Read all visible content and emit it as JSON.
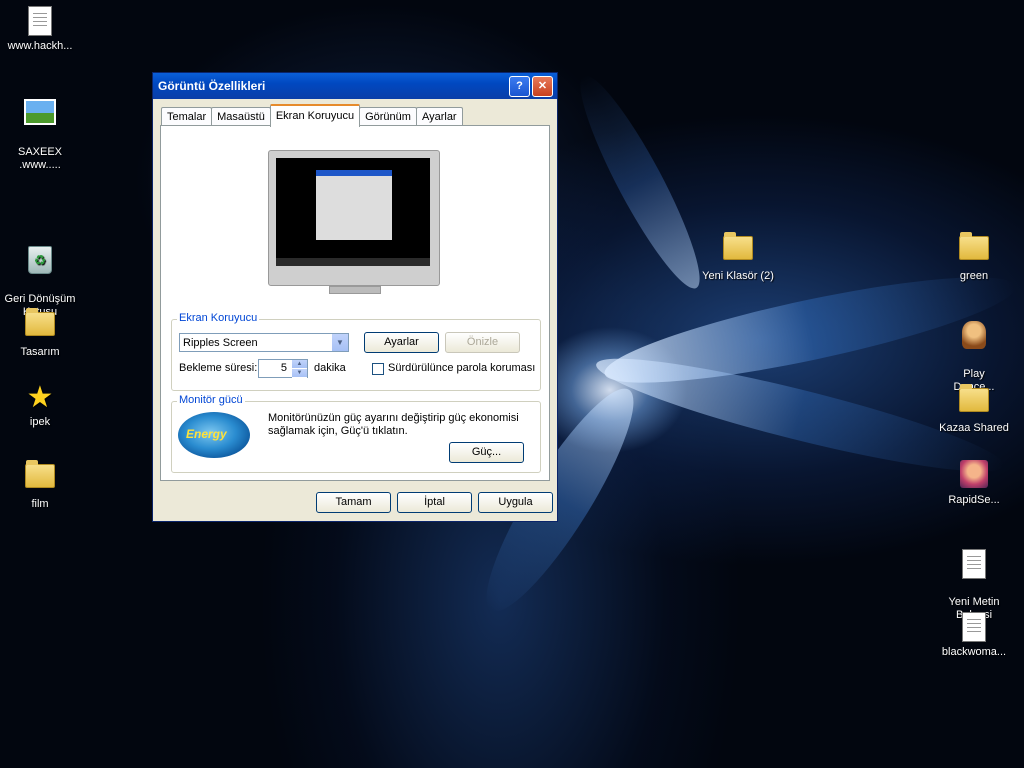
{
  "desktop": {
    "icons_left": [
      {
        "label": "www.hackh...",
        "icon": "document-icon"
      },
      {
        "label": "SAXEEX\n.www.....",
        "icon": "picture-icon"
      },
      {
        "label": "Geri Dönüşüm\nKutusu",
        "icon": "recycle-bin-icon"
      },
      {
        "label": "Tasarım",
        "icon": "folder-icon"
      },
      {
        "label": "ipek",
        "icon": "star-icon"
      },
      {
        "label": "film",
        "icon": "folder-icon"
      }
    ],
    "icons_right": [
      {
        "label": "Yeni Klasör (2)",
        "icon": "folder-icon"
      },
      {
        "label": "green",
        "icon": "folder-icon"
      },
      {
        "label": "Play\nDance...",
        "icon": "game-shortcut-icon"
      },
      {
        "label": "Kazaa Shared",
        "icon": "folder-shortcut-icon"
      },
      {
        "label": "RapidSe...",
        "icon": "app-icon"
      },
      {
        "label": "Yeni Metin\nBelgesi",
        "icon": "text-document-icon"
      },
      {
        "label": "blackwoma...",
        "icon": "text-document-icon"
      }
    ]
  },
  "dialog": {
    "title": "Görüntü Özellikleri",
    "help_glyph": "?",
    "close_glyph": "✕",
    "tabs": [
      "Temalar",
      "Masaüstü",
      "Ekran Koruyucu",
      "Görünüm",
      "Ayarlar"
    ],
    "active_tab": "Ekran Koruyucu",
    "screensaver": {
      "group_label": "Ekran Koruyucu",
      "selected": "Ripples Screen",
      "settings_label": "Ayarlar",
      "preview_label": "Önizle",
      "wait_label": "Bekleme süresi:",
      "wait_value": "5",
      "unit_label": "dakika",
      "resume_label": "Sürdürülünce parola koruması"
    },
    "power": {
      "group_label": "Monitör gücü",
      "logo_text": "Energy",
      "description": "Monitörünüzün güç ayarını değiştirip güç ekonomisi sağlamak için, Güç'ü tıklatın.",
      "button_label": "Güç..."
    },
    "buttons": {
      "ok": "Tamam",
      "cancel": "İptal",
      "apply": "Uygula"
    }
  }
}
